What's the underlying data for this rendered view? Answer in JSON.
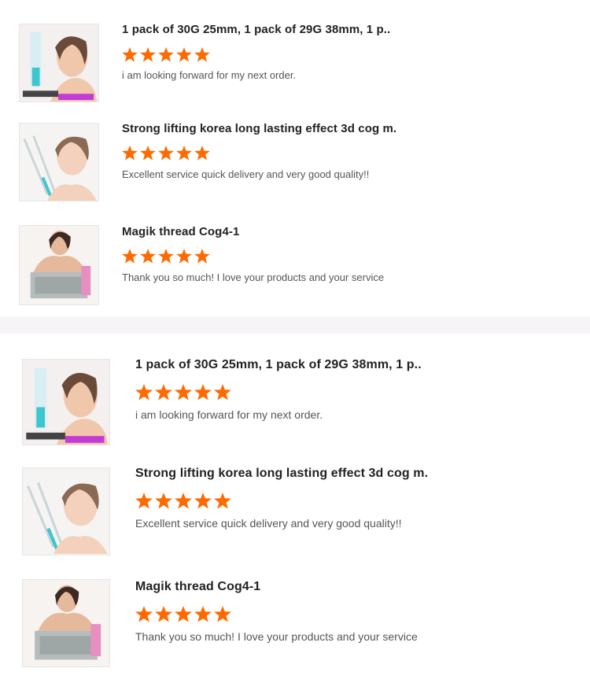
{
  "accent_color": "#ff6a00",
  "sections": [
    {
      "reviews": [
        {
          "title": "1 pack of 30G 25mm, 1 pack of 29G 38mm, 1 p..",
          "rating": 5,
          "comment": "i am looking forward for my next order.",
          "image": "product-photo-woman-face"
        },
        {
          "title": "Strong lifting korea long lasting effect 3d cog m.",
          "rating": 5,
          "comment": "Excellent service quick delivery and very good quality!!",
          "image": "product-photo-threads-woman"
        },
        {
          "title": "Magik thread Cog4-1",
          "rating": 5,
          "comment": "Thank you so much! I love your products and your service",
          "image": "product-photo-woman-box"
        }
      ]
    },
    {
      "reviews": [
        {
          "title": "1 pack of 30G 25mm, 1 pack of 29G 38mm, 1 p..",
          "rating": 5,
          "comment": "i am looking forward for my next order.",
          "image": "product-photo-woman-face"
        },
        {
          "title": "Strong lifting korea long lasting effect 3d cog m.",
          "rating": 5,
          "comment": "Excellent service quick delivery and very good quality!!",
          "image": "product-photo-threads-woman"
        },
        {
          "title": "Magik thread Cog4-1",
          "rating": 5,
          "comment": "Thank you so much! I love your products and your service",
          "image": "product-photo-woman-box"
        }
      ]
    }
  ]
}
